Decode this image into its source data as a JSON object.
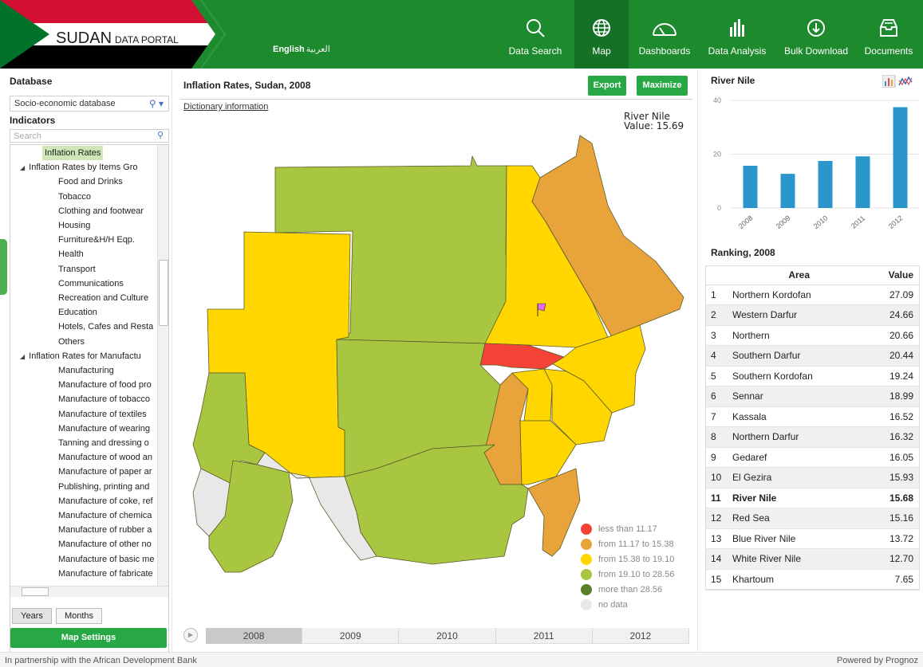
{
  "header": {
    "logo_main": "SUDAN",
    "logo_sub": "DATA PORTAL",
    "lang_en": "English",
    "lang_ar": "العربية",
    "flag_colors": {
      "red": "#d21034",
      "white": "#ffffff",
      "black": "#000000",
      "green": "#007229"
    },
    "nav": [
      {
        "label": "Data Search",
        "icon": "search-icon"
      },
      {
        "label": "Map",
        "icon": "globe-icon",
        "active": true
      },
      {
        "label": "Dashboards",
        "icon": "gauge-icon"
      },
      {
        "label": "Data Analysis",
        "icon": "bar-chart-icon"
      },
      {
        "label": "Bulk Download",
        "icon": "download-icon"
      },
      {
        "label": "Documents",
        "icon": "inbox-icon"
      }
    ]
  },
  "left": {
    "database_title": "Database",
    "database_value": "Socio-economic database",
    "indicators_title": "Indicators",
    "search_placeholder": "Search",
    "tree": [
      {
        "label": "Inflation Rates",
        "level": 2,
        "selected": true
      },
      {
        "label": "Inflation Rates by Items Gro",
        "level": 1,
        "expand": true
      },
      {
        "label": "Food and Drinks",
        "level": 3
      },
      {
        "label": "Tobacco",
        "level": 3
      },
      {
        "label": "Clothing and footwear",
        "level": 3
      },
      {
        "label": "Housing",
        "level": 3
      },
      {
        "label": "Furniture&H/H Eqp.",
        "level": 3
      },
      {
        "label": "Health",
        "level": 3
      },
      {
        "label": "Transport",
        "level": 3
      },
      {
        "label": "Communications",
        "level": 3
      },
      {
        "label": "Recreation and Culture",
        "level": 3
      },
      {
        "label": "Education",
        "level": 3
      },
      {
        "label": "Hotels, Cafes and Resta",
        "level": 3
      },
      {
        "label": "Others",
        "level": 3
      },
      {
        "label": "Inflation Rates for Manufactu",
        "level": 1,
        "expand": true
      },
      {
        "label": "Manufacturing",
        "level": 3
      },
      {
        "label": "Manufacture of food pro",
        "level": 3
      },
      {
        "label": "Manufacture of tobacco",
        "level": 3
      },
      {
        "label": "Manufacture of textiles",
        "level": 3
      },
      {
        "label": "Manufacture of wearing",
        "level": 3
      },
      {
        "label": "Tanning and dressing o",
        "level": 3
      },
      {
        "label": "Manufacture of wood an",
        "level": 3
      },
      {
        "label": "Manufacture of paper ar",
        "level": 3
      },
      {
        "label": "Publishing, printing and",
        "level": 3
      },
      {
        "label": "Manufacture of coke, ref",
        "level": 3
      },
      {
        "label": "Manufacture of chemica",
        "level": 3
      },
      {
        "label": "Manufacture of rubber a",
        "level": 3
      },
      {
        "label": "Manufacture of other no",
        "level": 3
      },
      {
        "label": "Manufacture of basic me",
        "level": 3
      },
      {
        "label": "Manufacture of fabricate",
        "level": 3
      }
    ],
    "years_btn": "Years",
    "months_btn": "Months",
    "map_settings_btn": "Map Settings"
  },
  "center": {
    "title": "Inflation Rates, Sudan, 2008",
    "export": "Export",
    "maximize": "Maximize",
    "dictionary": "Dictionary information",
    "tooltip_name": "River Nile",
    "tooltip_value": "Value: 15.69",
    "legend": [
      {
        "label": "less than 11.17",
        "color": "#f44336"
      },
      {
        "label": "from 11.17 to 15.38",
        "color": "#e8a33a"
      },
      {
        "label": "from 15.38 to 19.10",
        "color": "#ffd600"
      },
      {
        "label": "from 19.10 to 28.56",
        "color": "#a9c640"
      },
      {
        "label": "more than 28.56",
        "color": "#5a7f2a"
      },
      {
        "label": "no data",
        "color": "#e8e8e8"
      }
    ],
    "timeline": [
      {
        "label": "2008",
        "active": true
      },
      {
        "label": "2009"
      },
      {
        "label": "2010"
      },
      {
        "label": "2011"
      },
      {
        "label": "2012"
      }
    ]
  },
  "right": {
    "chart_title": "River Nile",
    "ranking_title": "Ranking, 2008",
    "table_headers": {
      "area": "Area",
      "value": "Value"
    },
    "ranking": [
      {
        "n": "1",
        "area": "Northern Kordofan",
        "value": "27.09"
      },
      {
        "n": "2",
        "area": "Western Darfur",
        "value": "24.66"
      },
      {
        "n": "3",
        "area": "Northern",
        "value": "20.66"
      },
      {
        "n": "4",
        "area": "Southern Darfur",
        "value": "20.44"
      },
      {
        "n": "5",
        "area": "Southern Kordofan",
        "value": "19.24"
      },
      {
        "n": "6",
        "area": "Sennar",
        "value": "18.99"
      },
      {
        "n": "7",
        "area": "Kassala",
        "value": "16.52"
      },
      {
        "n": "8",
        "area": "Northern Darfur",
        "value": "16.32"
      },
      {
        "n": "9",
        "area": "Gedaref",
        "value": "16.05"
      },
      {
        "n": "10",
        "area": "El Gezira",
        "value": "15.93"
      },
      {
        "n": "11",
        "area": "River Nile",
        "value": "15.68",
        "highlight": true
      },
      {
        "n": "12",
        "area": "Red Sea",
        "value": "15.16"
      },
      {
        "n": "13",
        "area": "Blue River Nile",
        "value": "13.72"
      },
      {
        "n": "14",
        "area": "White River Nile",
        "value": "12.70"
      },
      {
        "n": "15",
        "area": "Khartoum",
        "value": "7.65"
      }
    ]
  },
  "chart_data": {
    "type": "bar",
    "categories": [
      "2008",
      "2009",
      "2010",
      "2011",
      "2012"
    ],
    "values": [
      15.7,
      12.7,
      17.5,
      19.2,
      37.5
    ],
    "ylim": [
      0,
      40
    ],
    "yticks": [
      0,
      20,
      40
    ],
    "color": "#2a96cc",
    "grid": true
  },
  "footer": {
    "left": "In partnership with the African Development Bank",
    "right": "Powered by Prognoz"
  }
}
